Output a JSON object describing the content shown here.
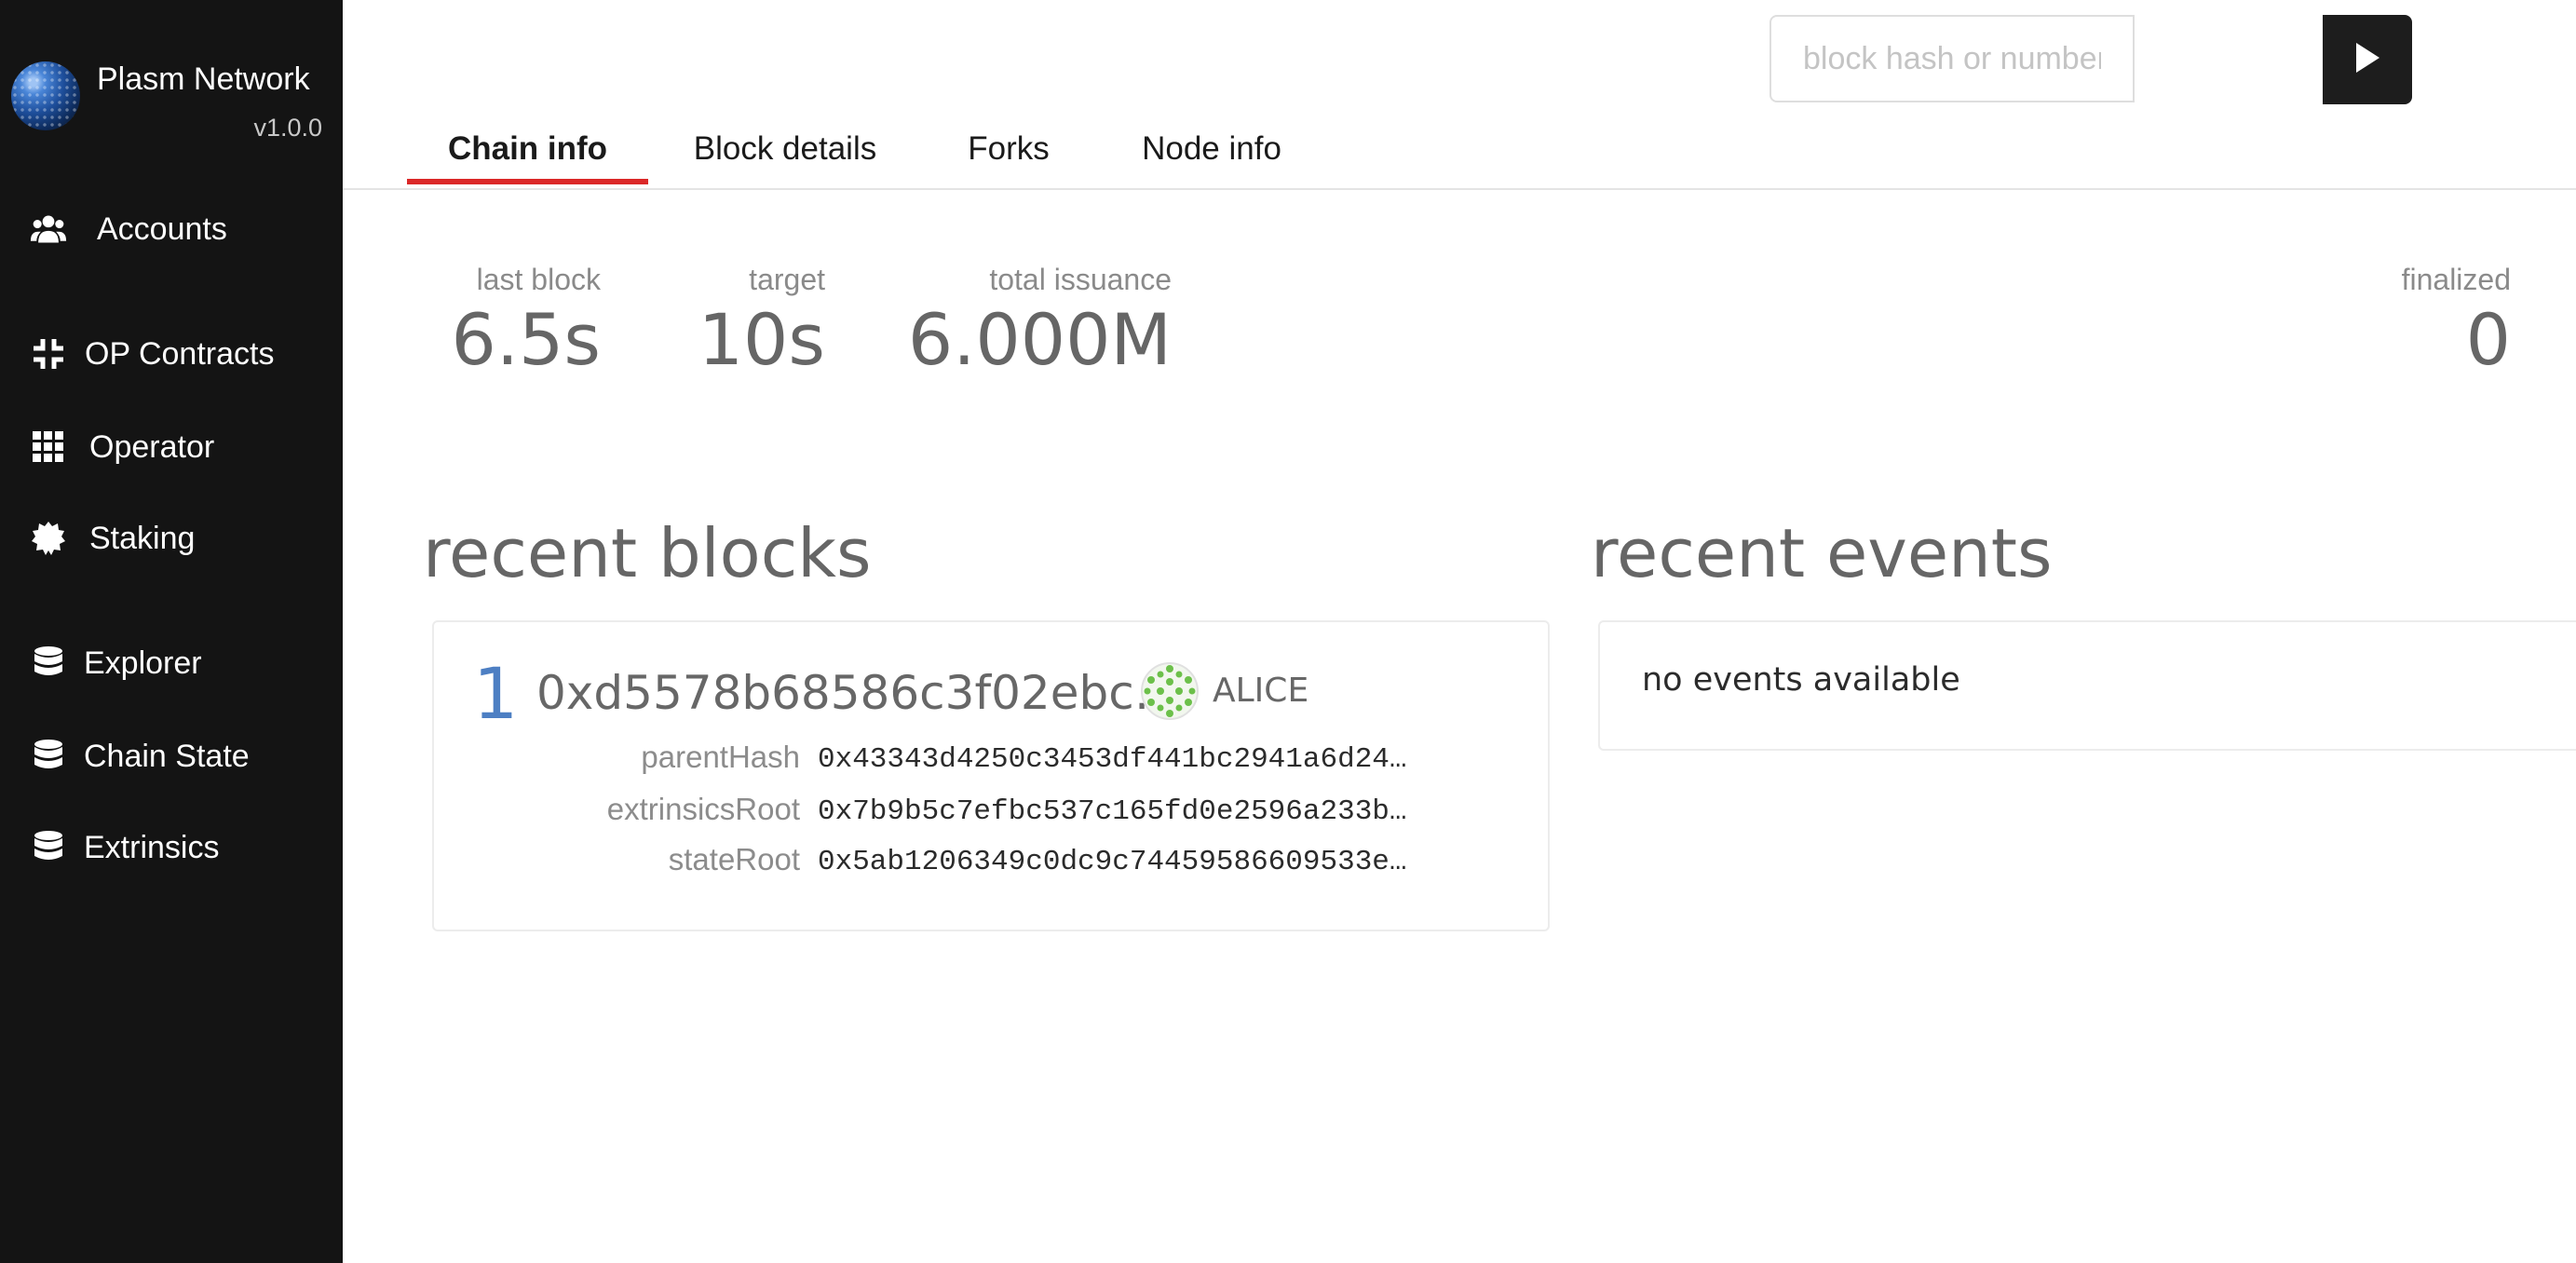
{
  "sidebar": {
    "brand": {
      "name": "Plasm Network",
      "version": "v1.0.0"
    },
    "items": [
      {
        "label": "Accounts",
        "icon": "users-icon"
      },
      {
        "label": "OP Contracts",
        "icon": "compress-icon"
      },
      {
        "label": "Operator",
        "icon": "grid-icon"
      },
      {
        "label": "Staking",
        "icon": "certificate-icon"
      },
      {
        "label": "Explorer",
        "icon": "database-icon"
      },
      {
        "label": "Chain State",
        "icon": "database-icon"
      },
      {
        "label": "Extrinsics",
        "icon": "database-icon"
      }
    ]
  },
  "search": {
    "placeholder": "block hash or number to query",
    "value": "",
    "submit_icon": "play-icon"
  },
  "tabs": [
    {
      "label": "Chain info",
      "active": true
    },
    {
      "label": "Block details",
      "active": false
    },
    {
      "label": "Forks",
      "active": false
    },
    {
      "label": "Node info",
      "active": false
    }
  ],
  "summary": {
    "last_block": {
      "label": "last block",
      "value": "6.5s"
    },
    "target": {
      "label": "target",
      "value": "10s"
    },
    "total_issuance": {
      "label": "total issuance",
      "value": "6.000M"
    },
    "finalized": {
      "label": "finalized",
      "value": "0"
    }
  },
  "recent_blocks": {
    "title": "recent blocks",
    "blocks": [
      {
        "number": "1",
        "hash": "0xd5578b68586c3f02ebc…",
        "author": "ALICE",
        "fields": [
          {
            "label": "parentHash",
            "value": "0x43343d4250c3453df441bc2941a6d24…"
          },
          {
            "label": "extrinsicsRoot",
            "value": "0x7b9b5c7efbc537c165fd0e2596a233b…"
          },
          {
            "label": "stateRoot",
            "value": "0x5ab1206349c0dc9c74459586609533e…"
          }
        ]
      }
    ]
  },
  "recent_events": {
    "title": "recent events",
    "empty_text": "no events available"
  },
  "colors": {
    "sidebar_bg": "#141414",
    "accent_tab": "#db2828",
    "block_number": "#4d7fc3",
    "identicon": "#6cc04a"
  }
}
